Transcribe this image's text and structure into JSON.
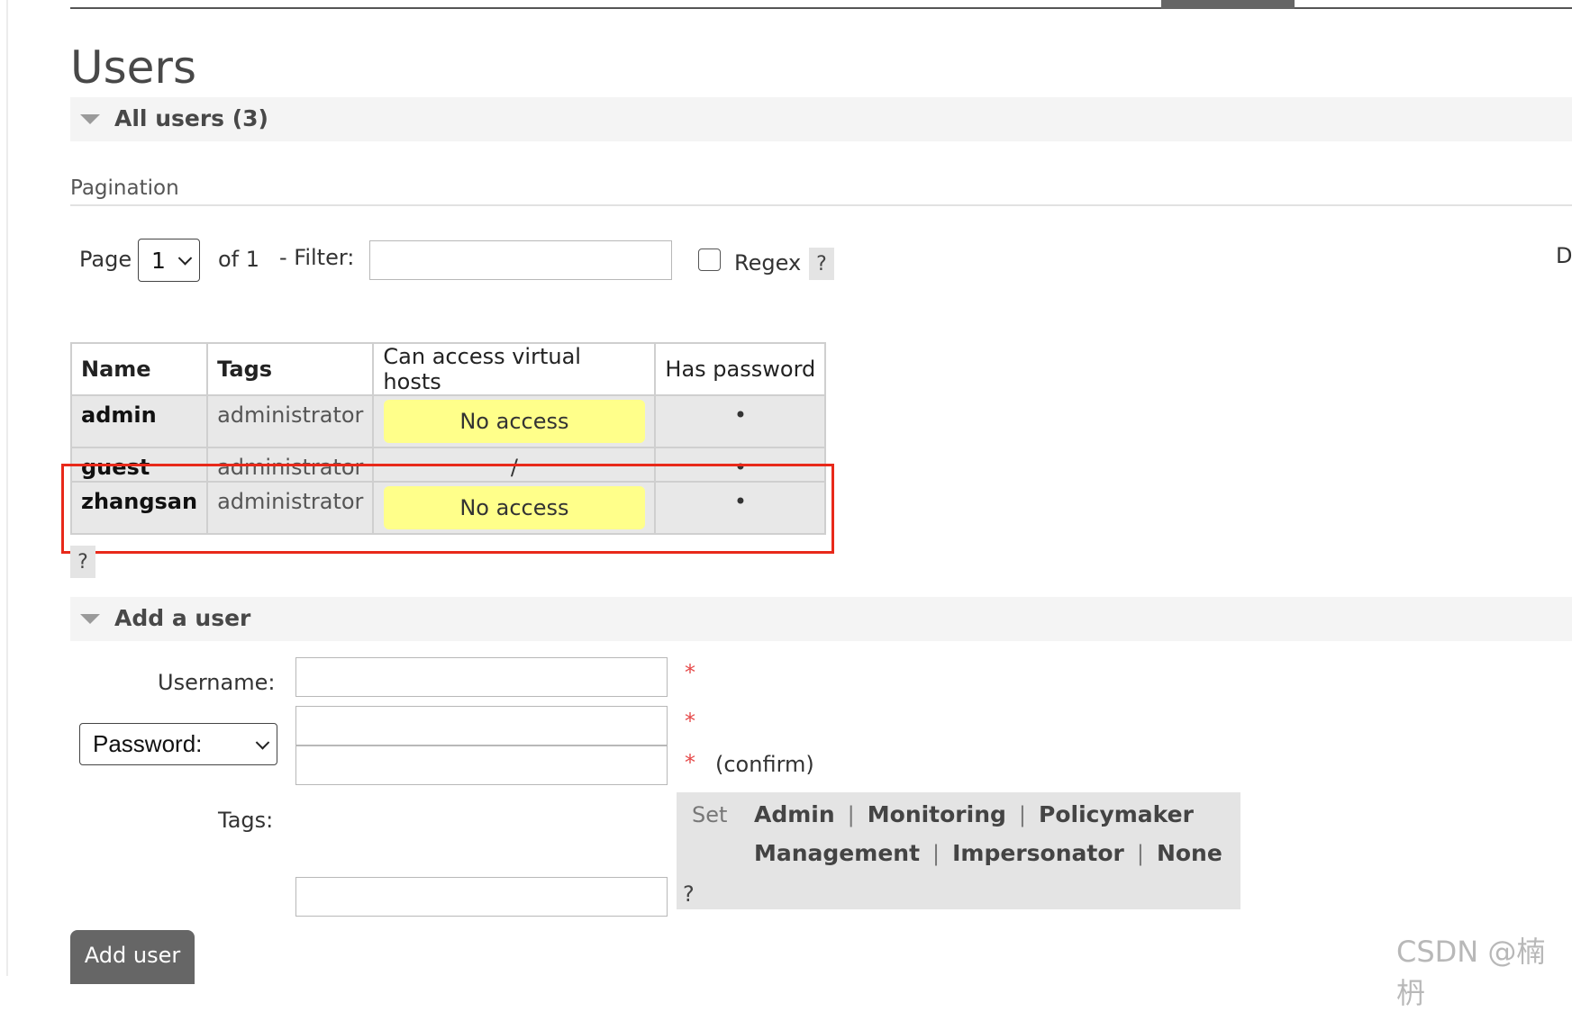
{
  "page": {
    "title": "Users"
  },
  "all_users_section": {
    "title": "All users (3)"
  },
  "pagination": {
    "label": "Pagination",
    "page_label": "Page",
    "page_value": "1",
    "of_label": "of 1",
    "filter_label": "- Filter:",
    "filter_value": "",
    "regex_label": "Regex",
    "regex_checked": false,
    "help": "?",
    "cut_text": "D"
  },
  "users_table": {
    "headers": [
      "Name",
      "Tags",
      "Can access virtual hosts",
      "Has password"
    ],
    "rows": [
      {
        "name": "admin",
        "tags": "administrator",
        "vhosts": "No access",
        "has_password": "•"
      },
      {
        "name": "guest",
        "tags": "administrator",
        "vhosts": "/",
        "has_password": "•"
      },
      {
        "name": "zhangsan",
        "tags": "administrator",
        "vhosts": "No access",
        "has_password": "•"
      }
    ],
    "help": "?"
  },
  "add_user_section": {
    "title": "Add a user",
    "username_label": "Username:",
    "password_select": "Password:",
    "required_mark": "*",
    "confirm_label": "(confirm)",
    "tags_label": "Tags:",
    "set_label": "Set",
    "tag_options": [
      "Admin",
      "Monitoring",
      "Policymaker",
      "Management",
      "Impersonator",
      "None"
    ],
    "separator": "|",
    "tags_help": "?",
    "submit_label": "Add user"
  },
  "watermark": "CSDN @楠枬",
  "colors": {
    "highlight_border": "#e8291a",
    "no_access_bg": "#ffff8a",
    "button_bg": "#666666"
  }
}
